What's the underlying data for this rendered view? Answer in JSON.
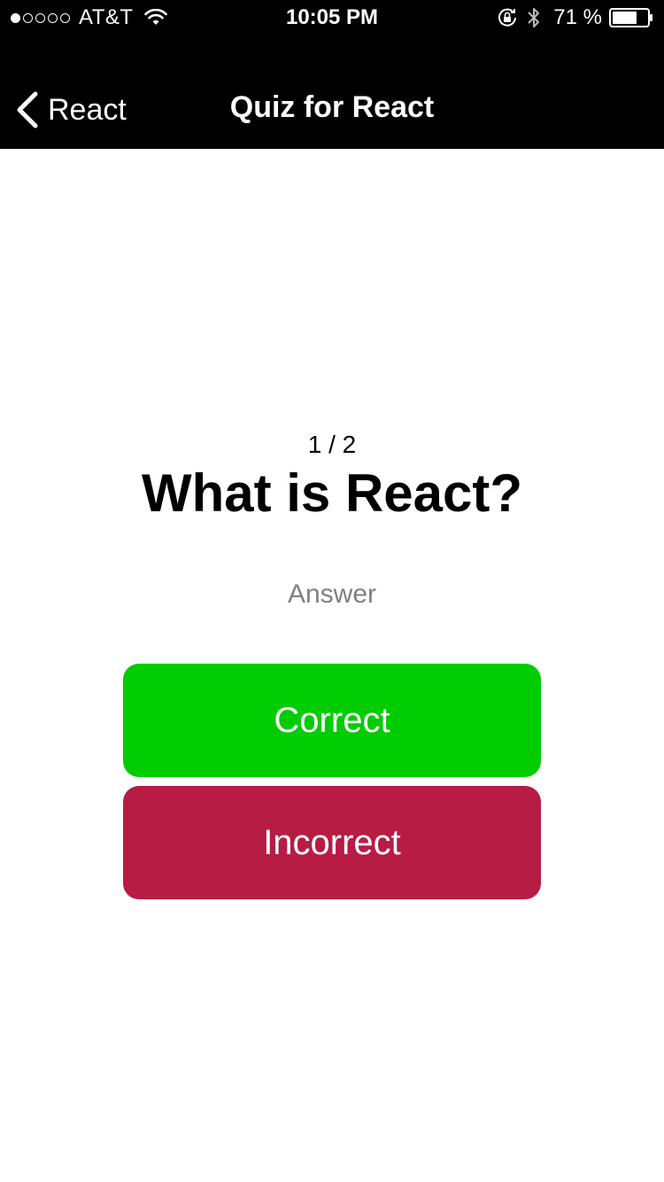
{
  "status_bar": {
    "signal_dots": [
      true,
      false,
      false,
      false,
      false
    ],
    "carrier": "AT&T",
    "time": "10:05 PM",
    "battery_percent": "71 %",
    "battery_level": 0.71,
    "icons": [
      "wifi-icon",
      "lock-rotation-icon",
      "bluetooth-icon",
      "battery-icon"
    ]
  },
  "nav": {
    "back_label": "React",
    "title": "Quiz for React"
  },
  "quiz": {
    "progress": "1 / 2",
    "question": "What is React?",
    "answer_link": "Answer"
  },
  "buttons": {
    "correct_label": "Correct",
    "incorrect_label": "Incorrect"
  },
  "colors": {
    "header_bg": "#000000",
    "correct": "#00cc00",
    "incorrect": "#b71c45",
    "answer_text": "#808080"
  }
}
